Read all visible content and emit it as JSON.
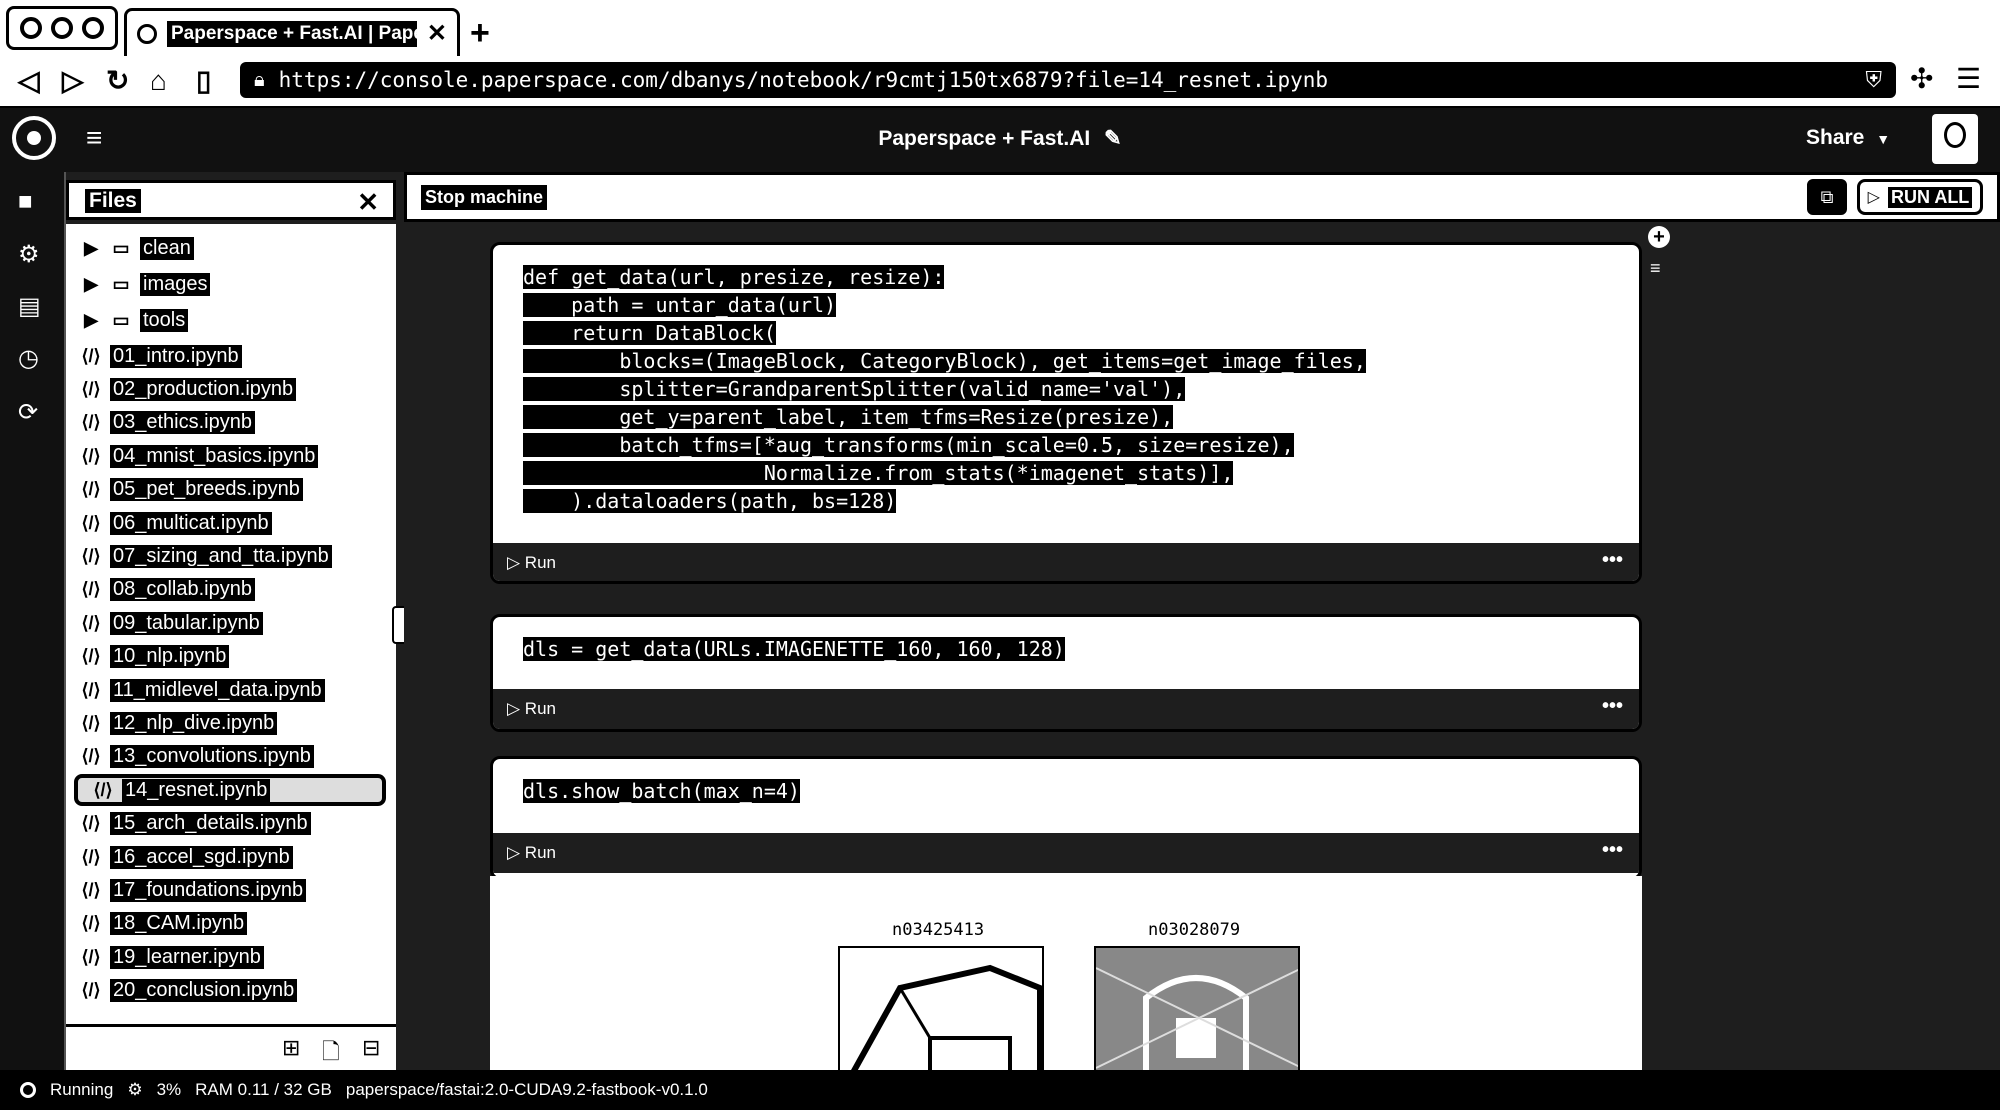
{
  "browser": {
    "tab_title": "Paperspace + Fast.AI | Papersp",
    "url": "https://console.paperspace.com/dbanys/notebook/r9cmtj150tx6879?file=14_resnet.ipynb"
  },
  "header": {
    "title": "Paperspace + Fast.AI",
    "share_label": "Share"
  },
  "files_panel": {
    "title": "Files",
    "folders": [
      "clean",
      "images",
      "tools"
    ],
    "files": [
      "01_intro.ipynb",
      "02_production.ipynb",
      "03_ethics.ipynb",
      "04_mnist_basics.ipynb",
      "05_pet_breeds.ipynb",
      "06_multicat.ipynb",
      "07_sizing_and_tta.ipynb",
      "08_collab.ipynb",
      "09_tabular.ipynb",
      "10_nlp.ipynb",
      "11_midlevel_data.ipynb",
      "12_nlp_dive.ipynb",
      "13_convolutions.ipynb",
      "14_resnet.ipynb",
      "15_arch_details.ipynb",
      "16_accel_sgd.ipynb",
      "17_foundations.ipynb",
      "18_CAM.ipynb",
      "19_learner.ipynb",
      "20_conclusion.ipynb"
    ],
    "selected_file": "14_resnet.ipynb"
  },
  "toolbar": {
    "stop_label": "Stop machine",
    "run_all_label": "RUN ALL"
  },
  "cells": [
    {
      "code": [
        "def get_data(url, presize, resize):",
        "    path = untar_data(url)",
        "    return DataBlock(",
        "        blocks=(ImageBlock, CategoryBlock), get_items=get_image_files,",
        "        splitter=GrandparentSplitter(valid_name='val'),",
        "        get_y=parent_label, item_tfms=Resize(presize),",
        "        batch_tfms=[*aug_transforms(min_scale=0.5, size=resize),",
        "                    Normalize.from_stats(*imagenet_stats)],",
        "    ).dataloaders(path, bs=128)"
      ],
      "run_label": "Run",
      "more": "•••"
    },
    {
      "code": [
        "dls = get_data(URLs.IMAGENETTE_160, 160, 128)"
      ],
      "run_label": "Run",
      "more": "•••"
    },
    {
      "code": [
        "dls.show_batch(max_n=4)"
      ],
      "run_label": "Run",
      "more": "•••"
    }
  ],
  "output": {
    "image_labels": [
      "n03425413",
      "n03028079"
    ]
  },
  "status_bar": {
    "state": "Running",
    "cpu": "3%",
    "ram": "RAM 0.11 / 32 GB",
    "container": "paperspace/fastai:2.0-CUDA9.2-fastbook-v0.1.0"
  }
}
